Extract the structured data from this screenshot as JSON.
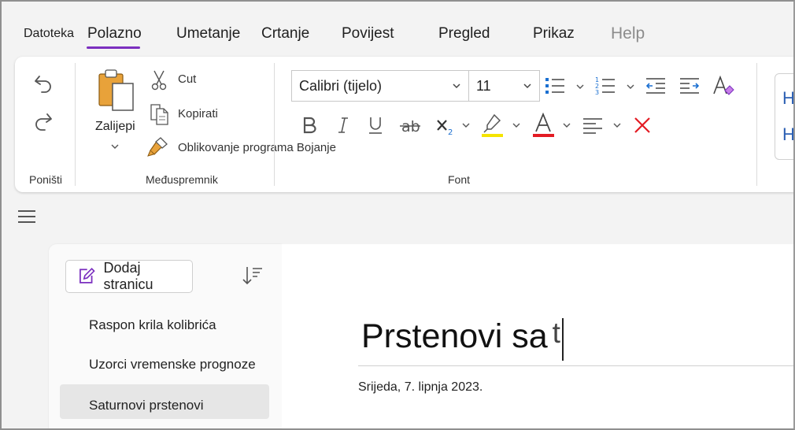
{
  "tabs": [
    {
      "label": "Datoteka"
    },
    {
      "label": "Polazno"
    },
    {
      "label": "Umetanje"
    },
    {
      "label": "Crtanje"
    },
    {
      "label": "Povijest"
    },
    {
      "label": "Pregled"
    },
    {
      "label": "Prikaz"
    },
    {
      "label": "Help"
    }
  ],
  "active_tab": "Polazno",
  "ribbon": {
    "undo_group_label": "Poništi",
    "clipboard": {
      "paste_label": "Zalijepi",
      "cut_label": "Cut",
      "copy_label": "Kopirati",
      "format_painter_label": "Oblikovanje programa Bojanje",
      "group_label": "Međuspremnik"
    },
    "font": {
      "font_name": "Calibri (tijelo)",
      "font_size": "11",
      "group_label": "Font",
      "highlight_color": "#f5e400",
      "font_color": "#e31b23"
    },
    "partial_styles": [
      "H",
      "H"
    ]
  },
  "sidebar": {
    "add_page_label": "Dodaj stranicu",
    "pages": [
      {
        "title": "Raspon krila kolibrića"
      },
      {
        "title": "Uzorci vremenske prognoze"
      },
      {
        "title": "Saturnovi prstenovi"
      }
    ],
    "selected_page": "Saturnovi prstenovi"
  },
  "page": {
    "title": "Prstenovi sa",
    "typed_char": "t",
    "date": "Srijeda, 7. lipnja 2023."
  },
  "colors": {
    "accent": "#7b2fbf",
    "list_blue": "#1a6fd1"
  }
}
